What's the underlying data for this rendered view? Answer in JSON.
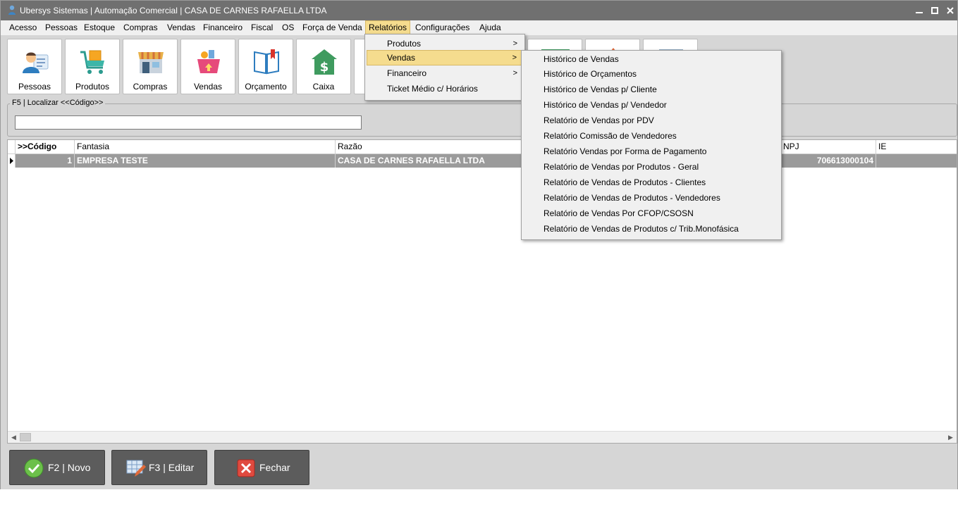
{
  "window": {
    "title": "Ubersys Sistemas | Automação Comercial | CASA DE CARNES RAFAELLA LTDA"
  },
  "menubar": {
    "items": [
      {
        "label": "Acesso"
      },
      {
        "label": "Pessoas"
      },
      {
        "label": "Estoque"
      },
      {
        "label": "Compras"
      },
      {
        "label": "Vendas"
      },
      {
        "label": "Financeiro"
      },
      {
        "label": "Fiscal"
      },
      {
        "label": "OS"
      },
      {
        "label": "Força de Venda"
      },
      {
        "label": "Relatórios",
        "active": true
      },
      {
        "label": "Configurações"
      },
      {
        "label": "Ajuda"
      }
    ]
  },
  "toolbar": {
    "buttons": [
      {
        "label": "Pessoas",
        "icon": "person-card-icon"
      },
      {
        "label": "Produtos",
        "icon": "shopping-cart-icon"
      },
      {
        "label": "Compras",
        "icon": "store-icon"
      },
      {
        "label": "Vendas",
        "icon": "basket-icon"
      },
      {
        "label": "Orçamento",
        "icon": "book-icon"
      },
      {
        "label": "Caixa",
        "icon": "money-house-icon"
      }
    ]
  },
  "locate": {
    "legend": "F5 | Localizar <<Código>>",
    "value": ""
  },
  "grid": {
    "columns": [
      ">>Código",
      "Fantasia",
      "Razão",
      "",
      "NPJ",
      "IE"
    ],
    "rows": [
      {
        "codigo": "1",
        "fantasia": "EMPRESA TESTE",
        "razao": "CASA DE CARNES RAFAELLA LTDA",
        "cnpj": "706613000104",
        "ie": ""
      }
    ]
  },
  "actions": {
    "novo": "F2 | Novo",
    "editar": "F3 | Editar",
    "fechar": "Fechar"
  },
  "relatorios_menu": {
    "items": [
      {
        "label": "Produtos",
        "submenu": true
      },
      {
        "label": "Vendas",
        "submenu": true,
        "active": true
      },
      {
        "label": "Financeiro",
        "submenu": true
      },
      {
        "label": "Ticket Médio c/ Horários",
        "submenu": false
      }
    ]
  },
  "vendas_submenu": {
    "items": [
      "Histórico de Vendas",
      "Histórico de Orçamentos",
      "Histórico de Vendas p/ Cliente",
      "Histórico de Vendas p/ Vendedor",
      "Relatório de Vendas por PDV",
      "Relatório Comissão de  Vendedores",
      "Relatório Vendas por Forma de Pagamento",
      "Relatório de Vendas por Produtos - Geral",
      "Relatório de Vendas de Produtos - Clientes",
      "Relatório de Vendas de Produtos - Vendedores",
      "Relatório de Vendas Por CFOP/CSOSN",
      "Relatório de Vendas de Produtos c/ Trib.Monofásica"
    ]
  },
  "colors": {
    "titlebar": "#707070",
    "menu_highlight": "#f5dc8e",
    "selected_row": "#9b9b9b",
    "action_button": "#5c5c5c"
  }
}
